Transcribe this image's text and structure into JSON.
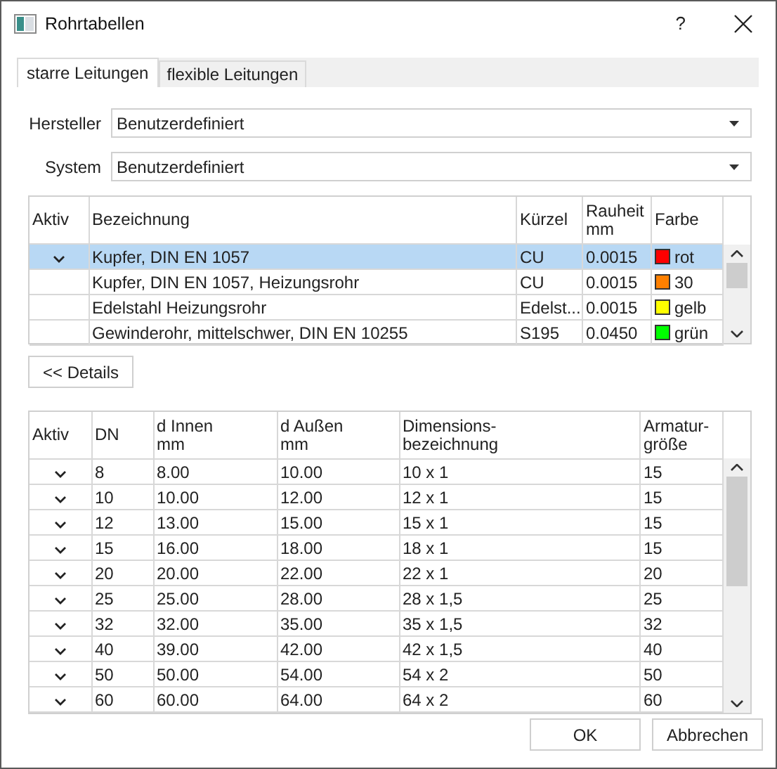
{
  "window": {
    "title": "Rohrtabellen",
    "help": "?"
  },
  "tabs": [
    {
      "label": "starre Leitungen",
      "selected": true
    },
    {
      "label": "flexible Leitungen",
      "selected": false
    }
  ],
  "fields": [
    {
      "label": "Hersteller",
      "value": "Benutzerdefiniert"
    },
    {
      "label": "System",
      "value": "Benutzerdefiniert"
    }
  ],
  "materials": {
    "columns": [
      "Aktiv",
      "Bezeichnung",
      "Kürzel",
      "Rauheit\nmm",
      "Farbe"
    ],
    "rows": [
      {
        "active": true,
        "selected": true,
        "name": "Kupfer, DIN EN 1057",
        "short": "CU",
        "roughness": "0.0015",
        "color": "#ff0000",
        "color_name": "rot"
      },
      {
        "active": false,
        "selected": false,
        "name": "Kupfer, DIN EN 1057, Heizungsrohr",
        "short": "CU",
        "roughness": "0.0015",
        "color": "#ff8000",
        "color_name": "30"
      },
      {
        "active": false,
        "selected": false,
        "name": "Edelstahl Heizungsrohr",
        "short": "Edelst...",
        "roughness": "0.0015",
        "color": "#ffff00",
        "color_name": "gelb"
      },
      {
        "active": false,
        "selected": false,
        "name": "Gewinderohr, mittelschwer, DIN EN 10255",
        "short": "S195",
        "roughness": "0.0450",
        "color": "#00ff00",
        "color_name": "grün"
      }
    ]
  },
  "details_button": "<< Details",
  "dimensions": {
    "columns": [
      "Aktiv",
      "DN",
      "d Innen\nmm",
      "d Außen\nmm",
      "Dimensions-\nbezeichnung",
      "Armatur-\ngröße"
    ],
    "rows": [
      {
        "active": true,
        "dn": "8",
        "d_inner": "8.00",
        "d_outer": "10.00",
        "designation": "10 x 1",
        "fitting_size": "15"
      },
      {
        "active": true,
        "dn": "10",
        "d_inner": "10.00",
        "d_outer": "12.00",
        "designation": "12 x 1",
        "fitting_size": "15"
      },
      {
        "active": true,
        "dn": "12",
        "d_inner": "13.00",
        "d_outer": "15.00",
        "designation": "15 x 1",
        "fitting_size": "15"
      },
      {
        "active": true,
        "dn": "15",
        "d_inner": "16.00",
        "d_outer": "18.00",
        "designation": "18 x 1",
        "fitting_size": "15"
      },
      {
        "active": true,
        "dn": "20",
        "d_inner": "20.00",
        "d_outer": "22.00",
        "designation": "22 x 1",
        "fitting_size": "20"
      },
      {
        "active": true,
        "dn": "25",
        "d_inner": "25.00",
        "d_outer": "28.00",
        "designation": "28 x 1,5",
        "fitting_size": "25"
      },
      {
        "active": true,
        "dn": "32",
        "d_inner": "32.00",
        "d_outer": "35.00",
        "designation": "35 x 1,5",
        "fitting_size": "32"
      },
      {
        "active": true,
        "dn": "40",
        "d_inner": "39.00",
        "d_outer": "42.00",
        "designation": "42 x 1,5",
        "fitting_size": "40"
      },
      {
        "active": true,
        "dn": "50",
        "d_inner": "50.00",
        "d_outer": "54.00",
        "designation": "54 x 2",
        "fitting_size": "50"
      },
      {
        "active": true,
        "dn": "60",
        "d_inner": "60.00",
        "d_outer": "64.00",
        "designation": "64 x 2",
        "fitting_size": "60"
      }
    ]
  },
  "buttons": [
    "OK",
    "Abbrechen"
  ]
}
